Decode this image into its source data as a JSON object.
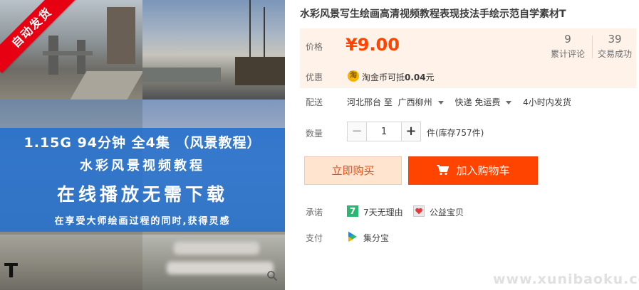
{
  "gallery": {
    "ribbon": "自动发货",
    "banner": {
      "line1": "1.15G  94分钟  全4集  （风景教程）",
      "line2": "水彩风景视频教程",
      "line3": "在线播放无需下载",
      "line4": "在享受大师绘画过程的同时,获得灵感"
    },
    "corner_mark": "T"
  },
  "product": {
    "title": "水彩风景写生绘画高清视频教程表现技法手绘示范自学素材T"
  },
  "price": {
    "label": "价格",
    "value": "¥9.00",
    "reviews_count": "9",
    "reviews_label": "累计评论",
    "sales_count": "39",
    "sales_label": "交易成功"
  },
  "promo": {
    "label": "优惠",
    "coin_icon": "淘",
    "text_prefix": "淘金币可抵",
    "amount": "0.04",
    "text_suffix": "元"
  },
  "shipping": {
    "label": "配送",
    "from": "河北邢台 至",
    "to": "广西柳州",
    "method": "快递 免运费",
    "time": "4小时内发货"
  },
  "quantity": {
    "label": "数量",
    "minus": "−",
    "value": "1",
    "plus": "+",
    "stock": "件(库存757件)"
  },
  "actions": {
    "buy_now": "立即购买",
    "add_to_cart": "加入购物车"
  },
  "promise": {
    "label": "承诺",
    "icon_seven": "7",
    "seven_day": "7天无理由",
    "charity": "公益宝贝"
  },
  "payment": {
    "label": "支付",
    "method": "集分宝"
  },
  "watermark": "www.xunibaoku.com",
  "colors": {
    "price_orange": "#ff4400",
    "panel_bg": "#fff2e8",
    "banner_blue": "#2470cd",
    "ribbon_red": "#e60012"
  }
}
